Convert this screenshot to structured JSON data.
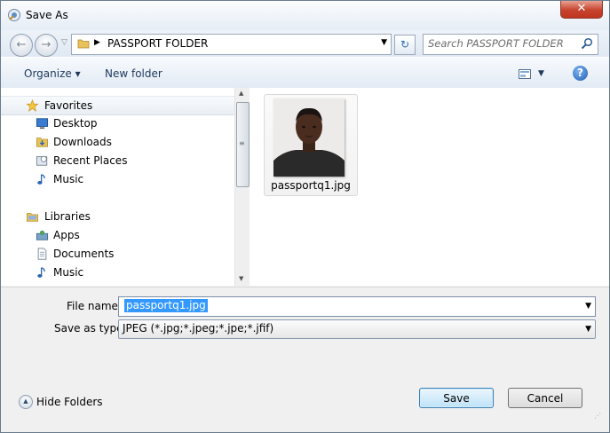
{
  "window": {
    "title": "Save As",
    "close_glyph": "✕"
  },
  "address": {
    "back_glyph": "←",
    "forward_glyph": "→",
    "recent_caret": "▽",
    "crumb_arrow": "▶",
    "path": "PASSPORT FOLDER",
    "drop_glyph": "▼",
    "refresh_glyph": "↻"
  },
  "search": {
    "placeholder": "Search PASSPORT FOLDER"
  },
  "toolbar": {
    "organize_label": "Organize ▾",
    "new_folder_label": "New folder",
    "view_caret": "▼",
    "help_glyph": "?"
  },
  "nav": {
    "favorites": "Favorites",
    "desktop": "Desktop",
    "downloads": "Downloads",
    "recent_places": "Recent Places",
    "music": "Music",
    "libraries": "Libraries",
    "apps": "Apps",
    "documents": "Documents",
    "music2": "Music"
  },
  "scroll": {
    "up": "▲",
    "down": "▼",
    "grip": "≡"
  },
  "files": [
    {
      "name": "passportq1.jpg"
    }
  ],
  "form": {
    "filename_label": "File name:",
    "filename_value": "passportq1.jpg",
    "filename_drop": "▼",
    "type_label": "Save as type:",
    "type_value": "JPEG (*.jpg;*.jpeg;*.jpe;*.jfif)",
    "type_drop": "▼"
  },
  "bottom": {
    "hide_glyph": "▲",
    "hide_folders_label": "Hide Folders",
    "save_label": "Save",
    "cancel_label": "Cancel",
    "grip": "⋰"
  },
  "colors": {
    "accent": "#3399ff",
    "title_bg": "#dfe8f3",
    "close_red": "#c7432e"
  }
}
